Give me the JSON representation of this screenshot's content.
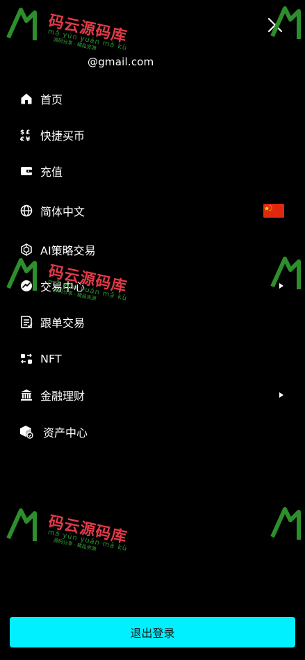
{
  "header": {
    "email": "@gmail.com"
  },
  "menu": {
    "items": [
      {
        "label": "首页",
        "icon": "home-icon"
      },
      {
        "label": "快捷买币",
        "icon": "currency-exchange-icon"
      },
      {
        "label": "充值",
        "icon": "wallet-icon"
      },
      {
        "label": "简体中文",
        "icon": "globe-icon",
        "flag": "china-flag"
      },
      {
        "label": "AI策略交易",
        "icon": "ai-cube-icon"
      },
      {
        "label": "交易中心",
        "icon": "trade-chart-icon",
        "has_arrow": true
      },
      {
        "label": "跟单交易",
        "icon": "document-icon"
      },
      {
        "label": "NFT",
        "icon": "nft-swap-icon"
      },
      {
        "label": "金融理财",
        "icon": "bank-icon",
        "has_arrow": true
      },
      {
        "label": "资产中心",
        "icon": "asset-box-icon"
      }
    ]
  },
  "footer": {
    "logout_label": "退出登录"
  },
  "watermark": {
    "title": "码云源码库",
    "subtitle": "mǎ yún yuán mǎ kù",
    "tagline": "源码分享 · 精品资源"
  },
  "colors": {
    "background": "#000000",
    "accent": "#00f0ff",
    "text": "#ffffff",
    "watermark_red": "#e23a48",
    "watermark_green": "#2c8f2c"
  }
}
